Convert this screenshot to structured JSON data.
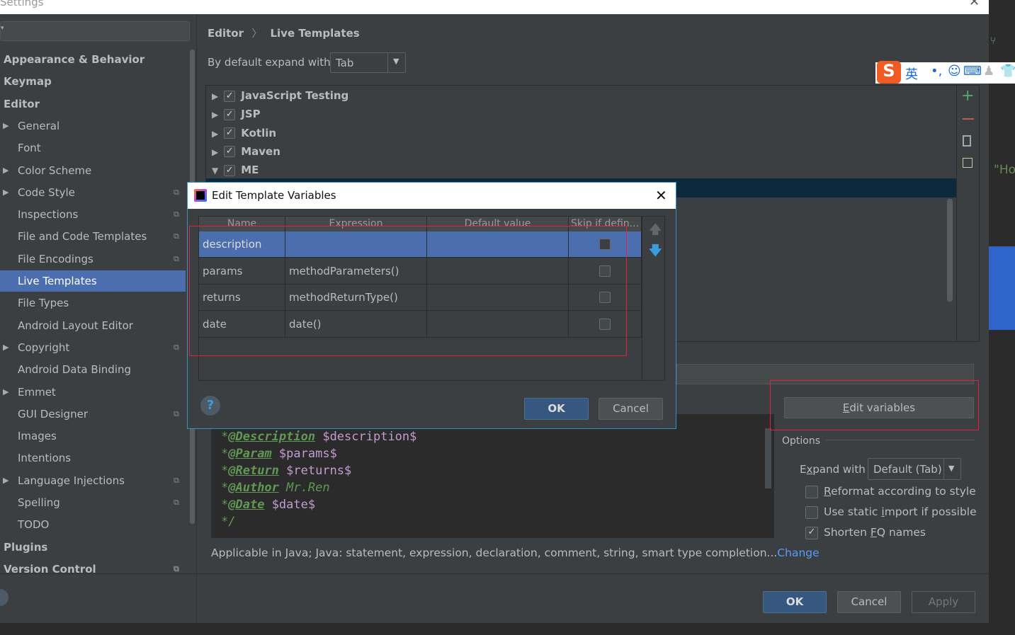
{
  "window": {
    "title": "Settings"
  },
  "sidebar": {
    "items": [
      {
        "label": "Appearance & Behavior",
        "level": 0
      },
      {
        "label": "Keymap",
        "level": 0
      },
      {
        "label": "Editor",
        "level": 0
      },
      {
        "label": "General",
        "level": 1,
        "expandable": true
      },
      {
        "label": "Font",
        "level": 1
      },
      {
        "label": "Color Scheme",
        "level": 1,
        "expandable": true
      },
      {
        "label": "Code Style",
        "level": 1,
        "expandable": true,
        "project": true
      },
      {
        "label": "Inspections",
        "level": 1,
        "project": true
      },
      {
        "label": "File and Code Templates",
        "level": 1,
        "project": true
      },
      {
        "label": "File Encodings",
        "level": 1,
        "project": true
      },
      {
        "label": "Live Templates",
        "level": 1,
        "selected": true
      },
      {
        "label": "File Types",
        "level": 1
      },
      {
        "label": "Android Layout Editor",
        "level": 1
      },
      {
        "label": "Copyright",
        "level": 1,
        "expandable": true,
        "project": true
      },
      {
        "label": "Android Data Binding",
        "level": 1
      },
      {
        "label": "Emmet",
        "level": 1,
        "expandable": true
      },
      {
        "label": "GUI Designer",
        "level": 1,
        "project": true
      },
      {
        "label": "Images",
        "level": 1
      },
      {
        "label": "Intentions",
        "level": 1
      },
      {
        "label": "Language Injections",
        "level": 1,
        "expandable": true,
        "project": true
      },
      {
        "label": "Spelling",
        "level": 1,
        "project": true
      },
      {
        "label": "TODO",
        "level": 1
      },
      {
        "label": "Plugins",
        "level": 0
      },
      {
        "label": "Version Control",
        "level": 0,
        "project": true
      }
    ]
  },
  "breadcrumb": {
    "parent": "Editor",
    "separator": "〉",
    "current": "Live Templates"
  },
  "expand_default": {
    "label": "By default expand with",
    "value": "Tab"
  },
  "tree": {
    "groups": [
      {
        "label": "JavaScript Testing",
        "checked": true,
        "expanded": false
      },
      {
        "label": "JSP",
        "checked": true,
        "expanded": false
      },
      {
        "label": "Kotlin",
        "checked": true,
        "expanded": false
      },
      {
        "label": "Maven",
        "checked": true,
        "expanded": false
      },
      {
        "label": "ME",
        "checked": true,
        "expanded": true
      }
    ]
  },
  "side_toolbar": [
    "add-icon",
    "remove-icon",
    "copy-icon",
    "restore-icon"
  ],
  "dialog": {
    "title": "Edit Template Variables",
    "columns": [
      "Name",
      "Expression",
      "Default value",
      "Skip if defin..."
    ],
    "rows": [
      {
        "name": "description",
        "expression": "",
        "default": "",
        "skip": false,
        "selected": true
      },
      {
        "name": "params",
        "expression": "methodParameters()",
        "default": "",
        "skip": false
      },
      {
        "name": "returns",
        "expression": "methodReturnType()",
        "default": "",
        "skip": false
      },
      {
        "name": "date",
        "expression": "date()",
        "default": "",
        "skip": false
      }
    ],
    "help": "?",
    "ok": "OK",
    "cancel": "Cancel"
  },
  "code": {
    "lines": [
      {
        "star": "*",
        "tag": "@Description",
        "rest": "$description$",
        "rest_type": "var"
      },
      {
        "star": "*",
        "tag": "@Param",
        "rest": "$params$",
        "rest_type": "var"
      },
      {
        "star": "*",
        "tag": "@Return",
        "rest": "$returns$",
        "rest_type": "var"
      },
      {
        "star": "*",
        "tag": "@Author",
        "rest": "Mr.Ren",
        "rest_type": "text"
      },
      {
        "star": "*",
        "tag": "@Date",
        "rest": "$date$",
        "rest_type": "var"
      },
      {
        "star": "*/",
        "tag": "",
        "rest": "",
        "rest_type": "text"
      }
    ]
  },
  "applicable": {
    "text": "Applicable in Java; Java: statement, expression, declaration, comment, string, smart type completion...",
    "link": "Change"
  },
  "edit_variables": {
    "mnemonic": "E",
    "rest": "dit variables"
  },
  "options": {
    "title": "Options",
    "expand_label_pre": "E",
    "expand_label_mn": "x",
    "expand_label_post": "pand with",
    "expand_value": "Default (Tab)",
    "checkboxes": [
      {
        "pre": "",
        "mn": "R",
        "post": "eformat according to style",
        "checked": false
      },
      {
        "pre": "Use static ",
        "mn": "i",
        "post": "mport if possible",
        "checked": false
      },
      {
        "pre": "Shorten ",
        "mn": "F",
        "post": "Q names",
        "checked": true
      }
    ]
  },
  "footer": {
    "ok": "OK",
    "cancel": "Cancel",
    "apply": "Apply"
  },
  "ime": {
    "logo": "S",
    "mode": "英",
    "punct": "•,"
  },
  "editor_bg_text": "\"Ho",
  "colors": {
    "accent": "#4b6eaf",
    "primary_button": "#365880",
    "link": "#589df6",
    "annotation": "#629755",
    "template_var": "#c39ccf",
    "highlight": "#e0223a"
  }
}
